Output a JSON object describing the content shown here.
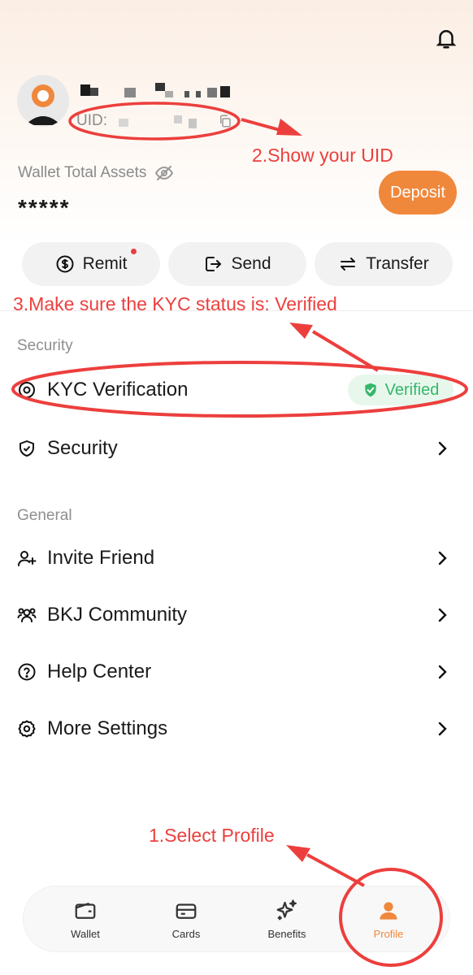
{
  "header": {
    "uid_label": "UID:"
  },
  "wallet": {
    "total_assets_label": "Wallet Total Assets",
    "balance": "*****",
    "deposit_label": "Deposit"
  },
  "actions": [
    {
      "label": "Remit",
      "icon": "dollar-circle-icon"
    },
    {
      "label": "Send",
      "icon": "send-icon"
    },
    {
      "label": "Transfer",
      "icon": "transfer-icon"
    }
  ],
  "security_section": {
    "title": "Security",
    "items": [
      {
        "label": "KYC Verification",
        "icon": "eye-target-icon",
        "status": "Verified"
      },
      {
        "label": "Security",
        "icon": "shield-check-icon"
      }
    ]
  },
  "general_section": {
    "title": "General",
    "items": [
      {
        "label": "Invite Friend",
        "icon": "user-plus-icon"
      },
      {
        "label": "BKJ Community",
        "icon": "community-icon"
      },
      {
        "label": "Help Center",
        "icon": "question-circle-icon"
      },
      {
        "label": "More Settings",
        "icon": "gear-icon"
      }
    ]
  },
  "tabbar": [
    {
      "label": "Wallet",
      "icon": "wallet-icon",
      "active": false
    },
    {
      "label": "Cards",
      "icon": "card-icon",
      "active": false
    },
    {
      "label": "Benefits",
      "icon": "sparkle-icon",
      "active": false
    },
    {
      "label": "Profile",
      "icon": "person-icon",
      "active": true
    }
  ],
  "annotations": {
    "step1": "1.Select Profile",
    "step2": "2.Show your UID",
    "step3": "3.Make sure the KYC status is: Verified"
  },
  "colors": {
    "accent": "#f0883c",
    "verified": "#35b76a",
    "annotation": "#ec3f3d"
  }
}
